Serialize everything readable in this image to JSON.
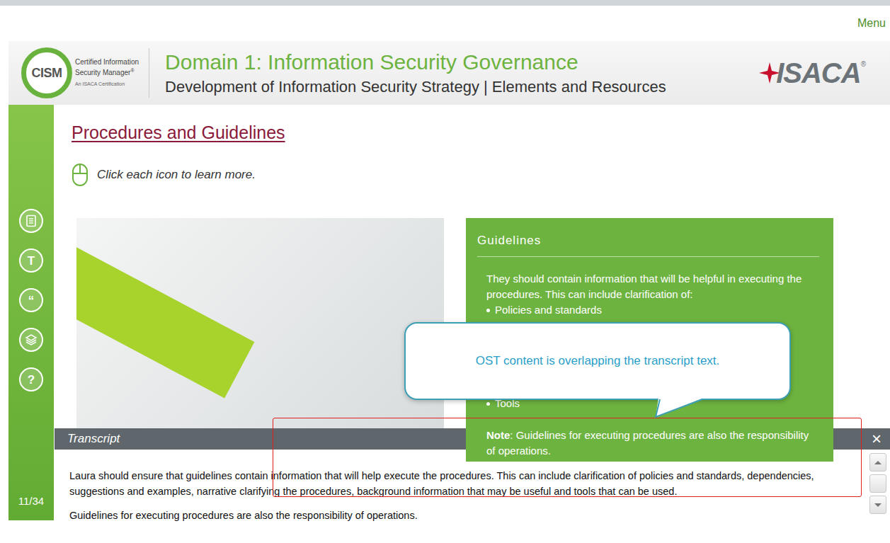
{
  "top_bar": {
    "menu": "Menu"
  },
  "header": {
    "logo": {
      "mark": "CISM",
      "line1": "Certified Information",
      "line2": "Security Manager",
      "registered": "®",
      "tagline": "An ISACA Certification"
    },
    "title": "Domain 1: Information Security Governance",
    "subtitle": "Development of Information Security Strategy | Elements and Resources",
    "brand": {
      "name": "ISACA",
      "registered": "®"
    }
  },
  "sidebar": {
    "items": [
      {
        "kind": "notes"
      },
      {
        "kind": "glyph",
        "glyph": "T"
      },
      {
        "kind": "glyph",
        "glyph": "“"
      },
      {
        "kind": "layers"
      },
      {
        "kind": "glyph",
        "glyph": "?"
      }
    ],
    "page": "11/34"
  },
  "page": {
    "title": "Procedures and Guidelines",
    "instruction": "Click each icon to learn more."
  },
  "panel": {
    "heading": "Guidelines",
    "intro": "They should contain information that will be helpful in executing the procedures. This can include clarification of:",
    "bullets": [
      "Policies and standards",
      "Tools"
    ],
    "note": {
      "label": "Note",
      "text": ": Guidelines for executing procedures are also the responsibility of operations."
    }
  },
  "transcript": {
    "title": "Transcript",
    "close": "×",
    "paragraphs": [
      "Laura should ensure that guidelines contain information that will help execute the procedures. This can include clarification of policies and standards, dependencies, suggestions and examples, narrative clarifying the procedures, background information that may be useful and tools that can be used.",
      "Guidelines for executing procedures are also the responsibility of operations."
    ]
  },
  "review_callout": {
    "text": "OST content is overlapping the transcript text."
  }
}
